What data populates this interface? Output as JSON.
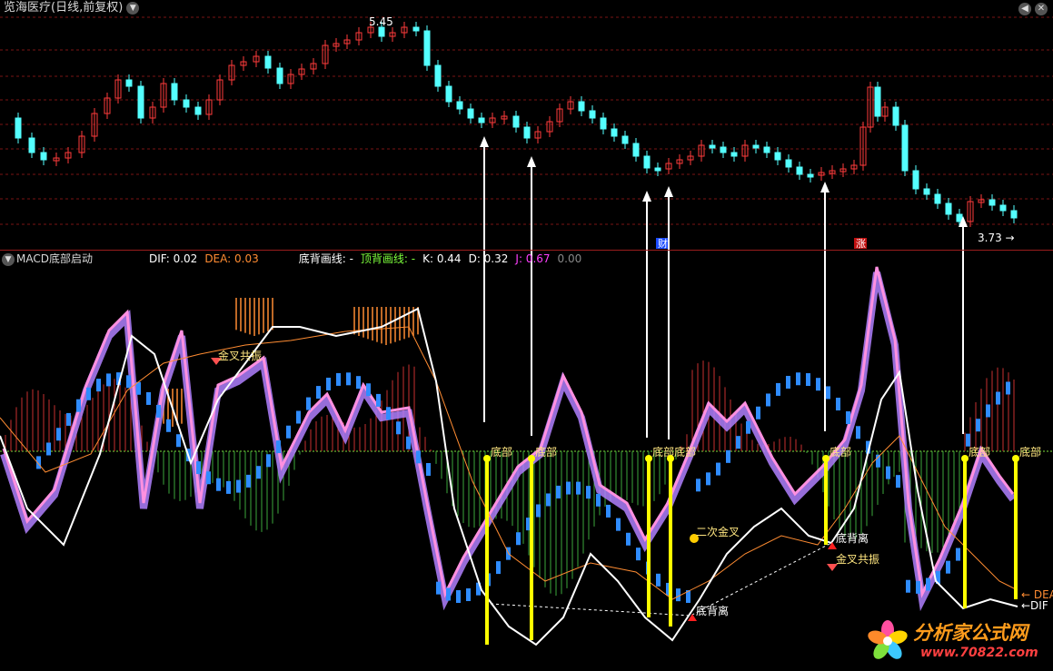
{
  "header": {
    "title": "览海医疗(日线,前复权)",
    "high_label": "5.45",
    "low_label": "3.73",
    "marker_buy": "财",
    "marker_rise": "涨"
  },
  "indicator": {
    "name": "MACD底部启动",
    "dif_label": "DIF: 0.02",
    "dea_label": "DEA: 0.03",
    "bottom_line_label": "底背画线: -",
    "top_line_label": "顶背画线: -",
    "k_label": "K: 0.44",
    "d_label": "D: 0.32",
    "j_label": "J: 0.67",
    "extra_label": "0.00",
    "right_dea": "DEA",
    "right_dif": "DIF"
  },
  "annotations": {
    "bottom": "底部",
    "golden_cross_resonance": "金叉共振",
    "second_golden_cross": "二次金叉",
    "bottom_divergence": "底背离"
  },
  "watermark": {
    "name": "分析家公式网",
    "url": "www.70822.com"
  },
  "colors": {
    "up": "#ff3b3b",
    "down": "#54ffff",
    "dif": "#ffffff",
    "dea": "#ff8c32",
    "bottom_signal": "#ffff00",
    "divider": "#9b1d1d"
  }
}
